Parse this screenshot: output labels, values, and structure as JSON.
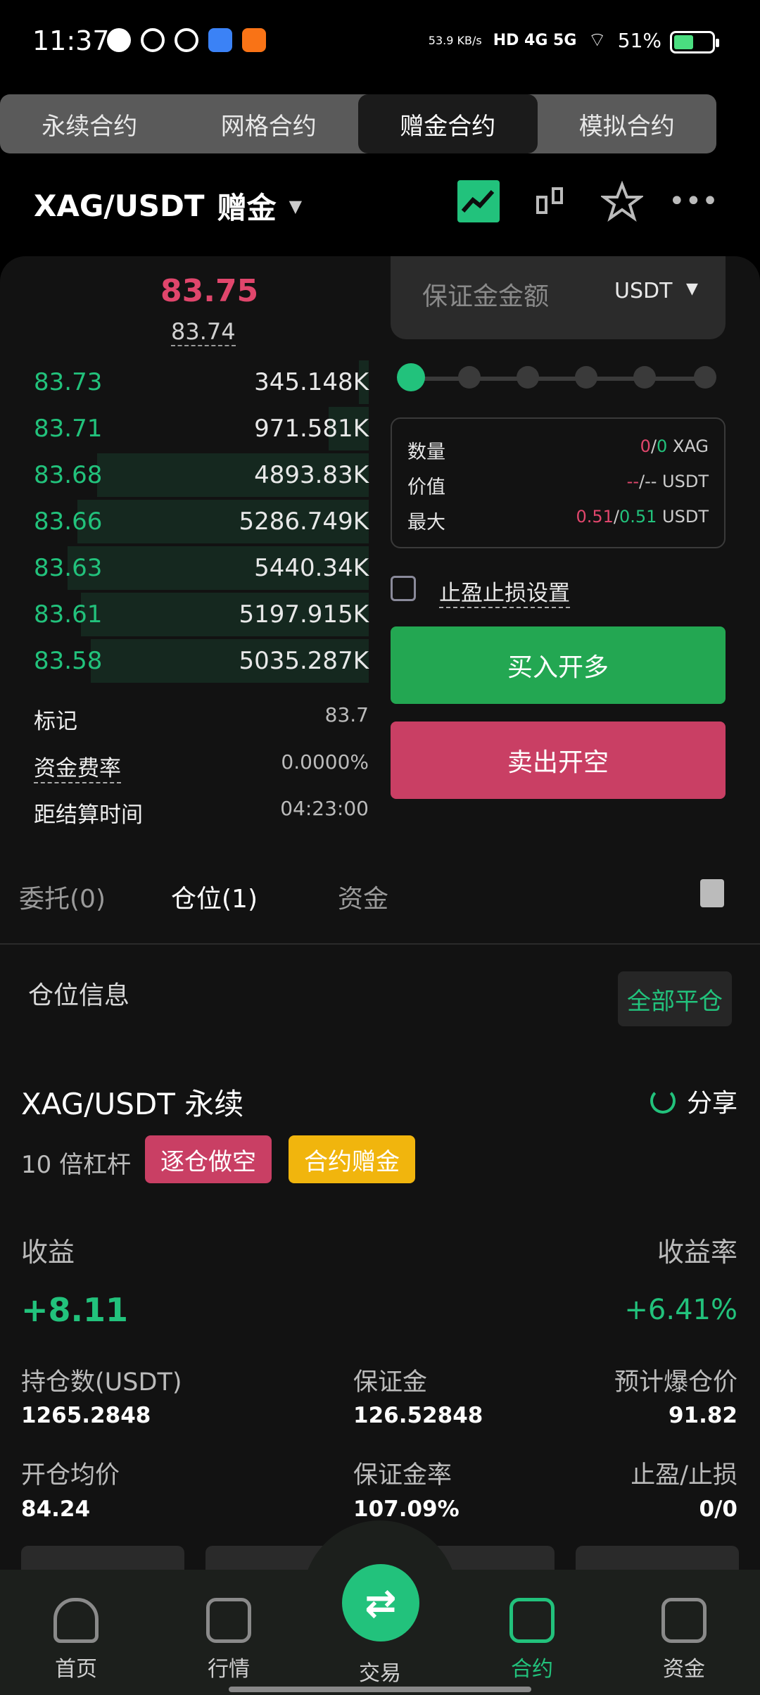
{
  "status_bar": {
    "time": "11:37",
    "net_speed": "53.9 KB/s",
    "signal": "HD 4G 5G",
    "battery": "51%",
    "battery_level": 0.51
  },
  "top_tabs": [
    "永续合约",
    "网格合约",
    "赠金合约",
    "模拟合约"
  ],
  "active_tab_index": 2,
  "header": {
    "pair": "XAG/USDT",
    "mode": "赠金"
  },
  "orderbook": {
    "last_price": "83.75",
    "index_price": "83.74",
    "bids": [
      {
        "price": "83.73",
        "qty": "345.148K",
        "depth": 0.03
      },
      {
        "price": "83.71",
        "qty": "971.581K",
        "depth": 0.12
      },
      {
        "price": "83.68",
        "qty": "4893.83K",
        "depth": 0.81
      },
      {
        "price": "83.66",
        "qty": "5286.749K",
        "depth": 0.87
      },
      {
        "price": "83.63",
        "qty": "5440.34K",
        "depth": 0.9
      },
      {
        "price": "83.61",
        "qty": "5197.915K",
        "depth": 0.86
      },
      {
        "price": "83.58",
        "qty": "5035.287K",
        "depth": 0.83
      }
    ],
    "mark_label": "标记",
    "mark_value": "83.7",
    "funding_label": "资金费率",
    "funding_value": "0.0000%",
    "settle_label": "距结算时间",
    "settle_value": "04:23:00"
  },
  "order_form": {
    "margin_placeholder": "保证金金额",
    "unit": "USDT",
    "leverage_slider_level": 0,
    "qty_label": "数量",
    "qty_a": "0",
    "qty_sep": "/",
    "qty_b": "0",
    "qty_unit": "XAG",
    "value_label": "价值",
    "value_a": "--",
    "value_b": "/--",
    "value_unit": "USDT",
    "max_label": "最大",
    "max_a": "0.51",
    "max_b": "0.51",
    "max_unit": "USDT",
    "tpsl_label": "止盈止损设置",
    "buy_label": "买入开多",
    "sell_label": "卖出开空"
  },
  "sub_tabs": [
    "委托(0)",
    "仓位(1)",
    "资金"
  ],
  "active_sub_tab": 1,
  "position": {
    "section_title": "仓位信息",
    "close_all_label": "全部平仓",
    "pair_title": "XAG/USDT 永续",
    "share_label": "分享",
    "leverage": "10 倍杠杆",
    "tag_short": "逐仓做空",
    "tag_bonus": "合约赠金",
    "pnl_label": "收益",
    "pnl_value": "+8.11",
    "roe_label": "收益率",
    "roe_value": "+6.41%",
    "size_label": "持仓数(USDT)",
    "size_value": "1265.2848",
    "margin_label": "保证金",
    "margin_value": "126.52848",
    "liq_label": "预计爆仓价",
    "liq_value": "91.82",
    "entry_label": "开仓均价",
    "entry_value": "84.24",
    "margin_ratio_label": "保证金率",
    "margin_ratio_value": "107.09%",
    "tpsl_label": "止盈/止损",
    "tpsl_value": "0/0"
  },
  "bottom_nav": [
    "首页",
    "行情",
    "交易",
    "合约",
    "资金"
  ],
  "active_nav": 3,
  "colors": {
    "green": "#22c27c",
    "red": "#e0466c",
    "buy": "#23a752",
    "sell": "#c93f64",
    "bonus": "#f1b50d"
  }
}
